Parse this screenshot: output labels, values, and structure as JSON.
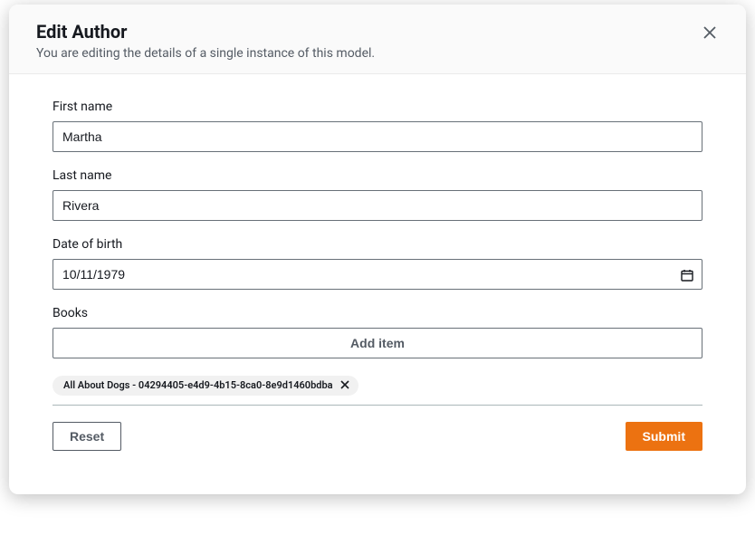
{
  "header": {
    "title": "Edit Author",
    "subtitle": "You are editing the details of a single instance of this model."
  },
  "fields": {
    "first_name": {
      "label": "First name",
      "value": "Martha"
    },
    "last_name": {
      "label": "Last name",
      "value": "Rivera"
    },
    "dob": {
      "label": "Date of birth",
      "value": "10/11/1979"
    },
    "books": {
      "label": "Books",
      "add_label": "Add item",
      "items": [
        {
          "label": "All About Dogs - 04294405-e4d9-4b15-8ca0-8e9d1460bdba"
        }
      ]
    }
  },
  "footer": {
    "reset_label": "Reset",
    "submit_label": "Submit"
  }
}
